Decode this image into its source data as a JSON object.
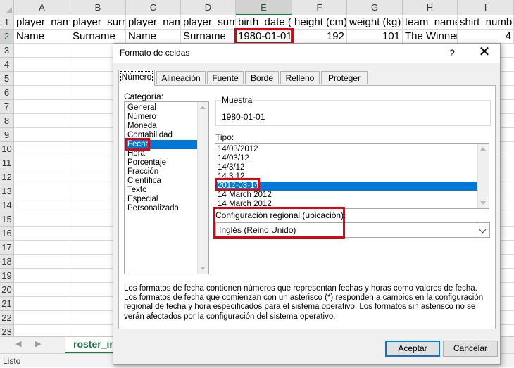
{
  "columns": [
    {
      "letter": "A",
      "header": "player_name"
    },
    {
      "letter": "B",
      "header": "player_surname"
    },
    {
      "letter": "C",
      "header": "player_name"
    },
    {
      "letter": "D",
      "header": "player_surname"
    },
    {
      "letter": "E",
      "header": "birth_date (y"
    },
    {
      "letter": "F",
      "header": "height (cm)"
    },
    {
      "letter": "G",
      "header": "weight (kg)"
    },
    {
      "letter": "H",
      "header": "team_name"
    },
    {
      "letter": "I",
      "header": "shirt_number"
    }
  ],
  "row2": [
    "Name",
    "Surname",
    "Name",
    "Surname",
    "1980-01-01",
    "192",
    "101",
    "The Winners",
    "4"
  ],
  "row_numbers": [
    "1",
    "2",
    "3",
    "4",
    "5",
    "6",
    "7",
    "8",
    "9",
    "10",
    "11",
    "12",
    "13",
    "14",
    "15",
    "16",
    "17",
    "18",
    "19",
    "20",
    "21",
    "22",
    "23"
  ],
  "sheet_tab": "roster_im",
  "status": "Listo",
  "nav": {
    "prev": "◀",
    "next": "▶"
  },
  "dialog": {
    "title": "Formato de celdas",
    "help": "?",
    "close": "✕",
    "tabs": [
      "Número",
      "Alineación",
      "Fuente",
      "Borde",
      "Relleno",
      "Proteger"
    ],
    "category_label": "Categoría:",
    "categories": [
      "General",
      "Número",
      "Moneda",
      "Contabilidad",
      "Fecha",
      "Hora",
      "Porcentaje",
      "Fracción",
      "Científica",
      "Texto",
      "Especial",
      "Personalizada"
    ],
    "selected_category": "Fecha",
    "sample_label": "Muestra",
    "sample_value": "1980-01-01",
    "type_label": "Tipo:",
    "types": [
      "14/03/2012",
      "14/03/12",
      "14/3/12",
      "14.3.12",
      "2012-03-14",
      "14 March 2012",
      "14 March 2012"
    ],
    "selected_type": "2012-03-14",
    "locale_label": "Configuración regional (ubicación):",
    "locale_value": "Inglés (Reino Unido)",
    "description": "Los formatos de fecha contienen números que representan fechas y horas como valores de fecha. Los formatos de fecha que comienzan con un asterisco (*) responden a cambios en la configuración regional de fecha y hora especificados para el sistema operativo. Los formatos sin asterisco no se verán afectados por la configuración del sistema operativo.",
    "ok": "Aceptar",
    "cancel": "Cancelar"
  },
  "colors": {
    "accent": "#217346",
    "selection": "#0078d7",
    "highlight": "#e3000f"
  }
}
